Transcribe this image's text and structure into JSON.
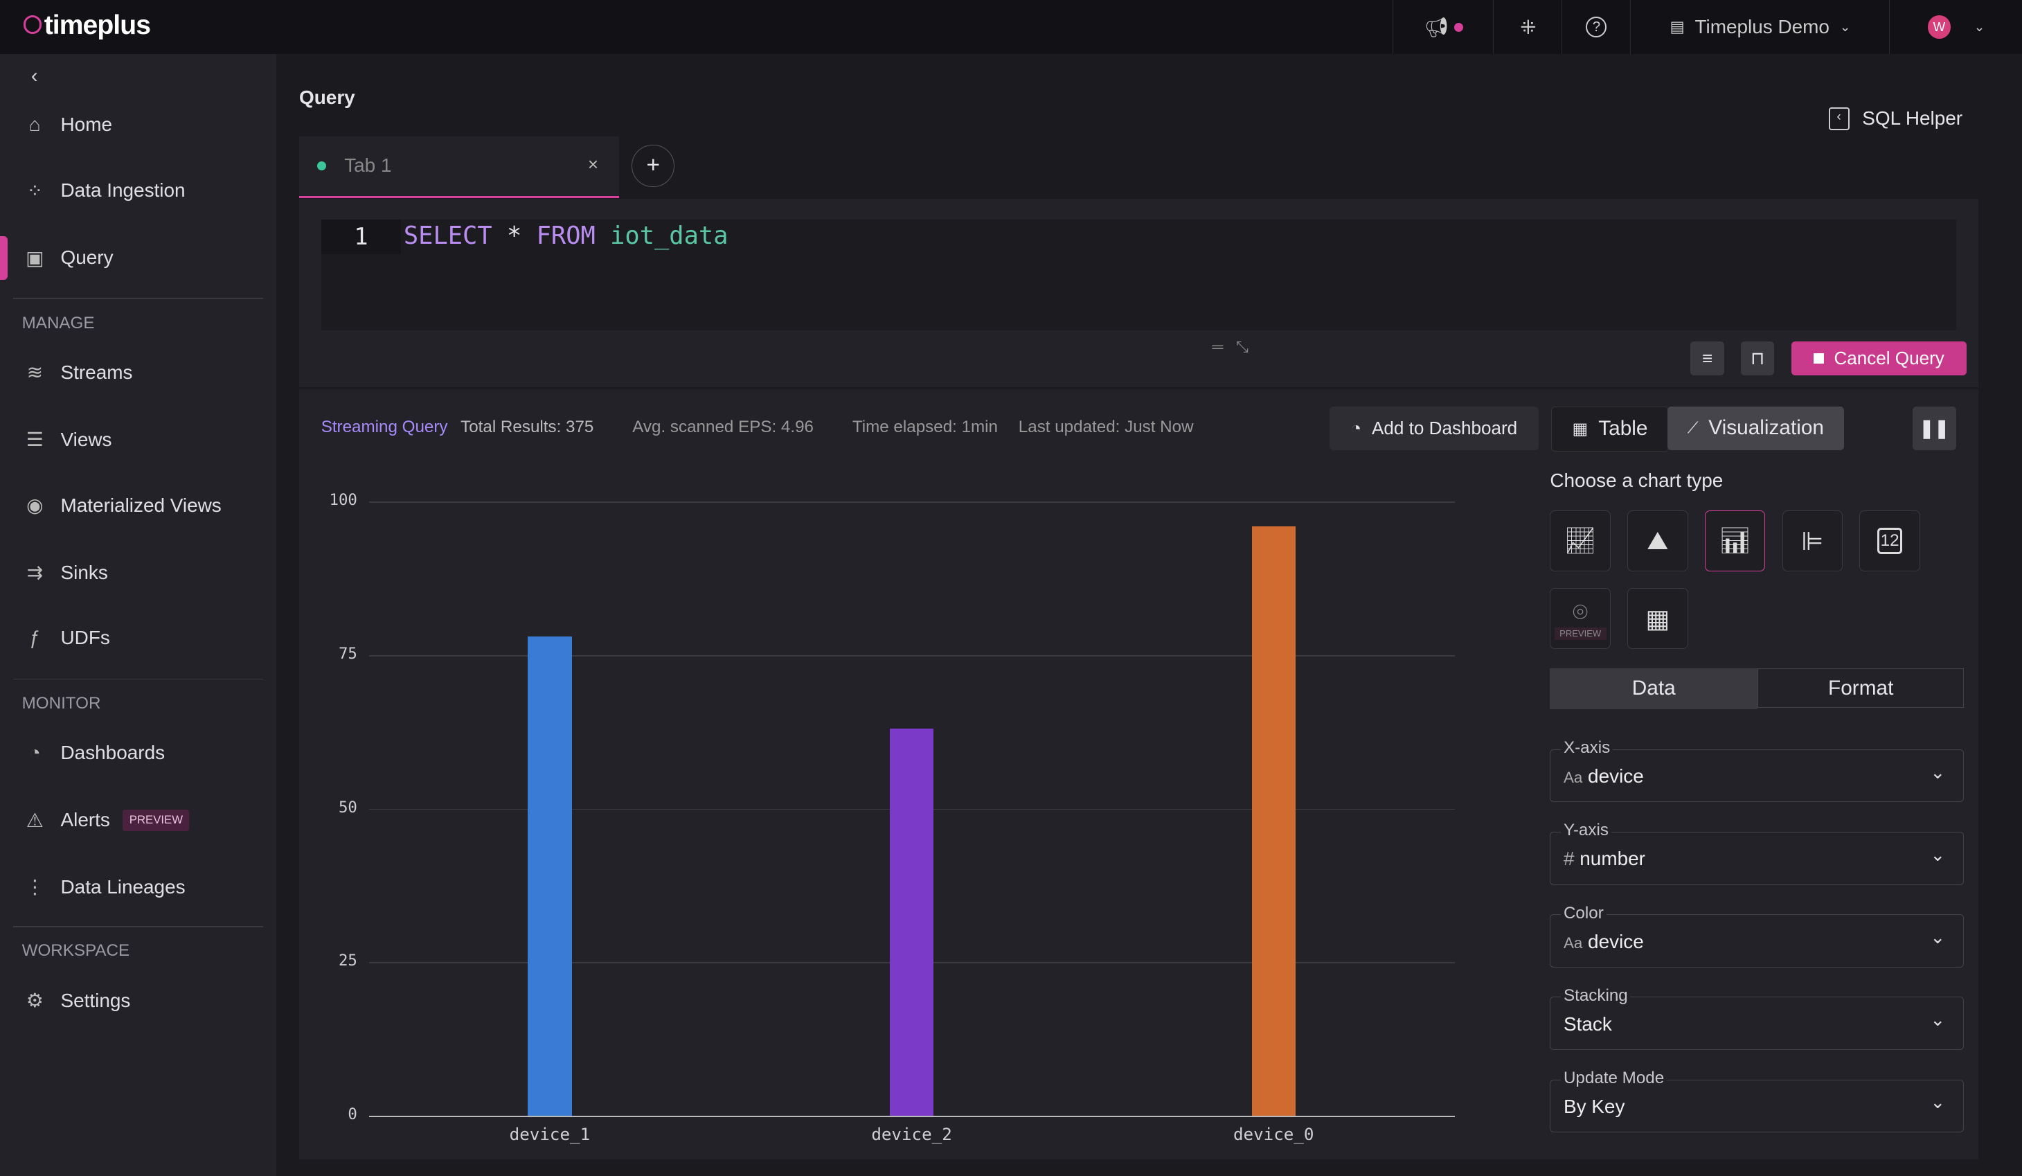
{
  "header": {
    "logo": "timeplus",
    "workspace": "Timeplus Demo",
    "avatar": "W"
  },
  "sidebar": {
    "items": [
      {
        "label": "Home",
        "icon": "home-icon"
      },
      {
        "label": "Data Ingestion",
        "icon": "ingestion-icon"
      },
      {
        "label": "Query",
        "icon": "query-icon",
        "active": true
      }
    ],
    "manage_label": "MANAGE",
    "manage": [
      {
        "label": "Streams"
      },
      {
        "label": "Views"
      },
      {
        "label": "Materialized Views"
      },
      {
        "label": "Sinks"
      },
      {
        "label": "UDFs"
      }
    ],
    "monitor_label": "MONITOR",
    "monitor": [
      {
        "label": "Dashboards"
      },
      {
        "label": "Alerts",
        "badge": "PREVIEW"
      },
      {
        "label": "Data Lineages"
      }
    ],
    "workspace_label": "WORKSPACE",
    "workspace": [
      {
        "label": "Settings"
      }
    ]
  },
  "page": {
    "title": "Query",
    "sql_helper": "SQL Helper"
  },
  "tabs": [
    {
      "label": "Tab 1"
    }
  ],
  "editor": {
    "line": "1",
    "kw1": "SELECT",
    "star": "*",
    "kw2": "FROM",
    "table": "iot_data",
    "cancel": "Cancel Query"
  },
  "status": {
    "mode": "Streaming Query",
    "total": "Total Results: 375",
    "eps": "Avg. scanned EPS: 4.96",
    "elapsed": "Time elapsed: 1min",
    "updated": "Last updated: Just Now"
  },
  "toolbar": {
    "add_dashboard": "Add to Dashboard",
    "table": "Table",
    "visualization": "Visualization"
  },
  "config": {
    "choose": "Choose a chart type",
    "preview": "PREVIEW",
    "tabs": [
      "Data",
      "Format"
    ],
    "fields": [
      {
        "label": "X-axis",
        "value": "device",
        "type": "Aa"
      },
      {
        "label": "Y-axis",
        "value": "number",
        "type": "#"
      },
      {
        "label": "Color",
        "value": "device",
        "type": "Aa"
      },
      {
        "label": "Stacking",
        "value": "Stack",
        "type": ""
      },
      {
        "label": "Update Mode",
        "value": "By Key",
        "type": ""
      }
    ]
  },
  "chart_data": {
    "type": "bar",
    "categories": [
      "device_1",
      "device_2",
      "device_0"
    ],
    "values": [
      78,
      63,
      96
    ],
    "colors": [
      "#3a7bd5",
      "#7b3ac8",
      "#cf6a30"
    ],
    "ylim": [
      0,
      100
    ],
    "yticks": [
      "0",
      "25",
      "50",
      "75",
      "100"
    ],
    "grid": true
  }
}
